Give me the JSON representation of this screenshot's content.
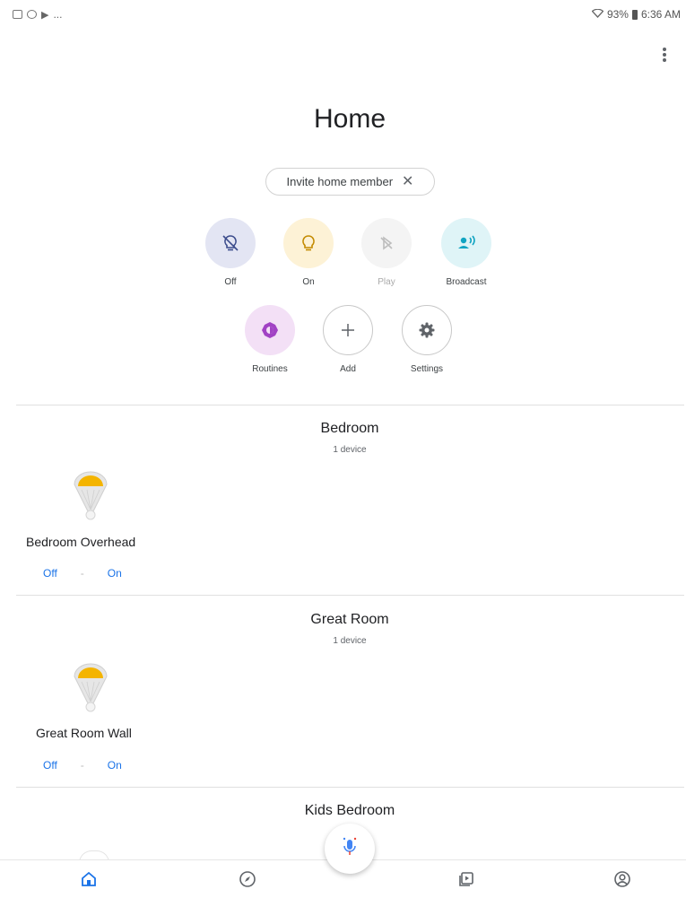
{
  "status_bar": {
    "left_extra": "...",
    "battery_text": "93%",
    "time": "6:36 AM"
  },
  "page": {
    "title": "Home"
  },
  "invite_chip": {
    "label": "Invite home member",
    "close": "✕"
  },
  "actions": {
    "off": "Off",
    "on": "On",
    "play": "Play",
    "broadcast": "Broadcast",
    "routines": "Routines",
    "add": "Add",
    "settings": "Settings"
  },
  "rooms": [
    {
      "name": "Bedroom",
      "count": "1 device",
      "device": {
        "name": "Bedroom Overhead",
        "off": "Off",
        "sep": "-",
        "on": "On"
      }
    },
    {
      "name": "Great Room",
      "count": "1 device",
      "device": {
        "name": "Great Room Wall",
        "off": "Off",
        "sep": "-",
        "on": "On"
      }
    },
    {
      "name": "Kids Bedroom"
    }
  ],
  "colors": {
    "accent_blue": "#1a73e8",
    "bulb_yellow": "#f4b400",
    "routines_purple": "#a142c4",
    "broadcast_teal": "#12a4c2"
  },
  "icons": {
    "off": "lightbulb-off-icon",
    "on": "lightbulb-icon",
    "play": "play-disabled-icon",
    "broadcast": "broadcast-icon",
    "routines": "routines-icon",
    "add": "plus-icon",
    "settings": "gear-icon",
    "mic": "microphone-icon",
    "nav_home": "home-icon",
    "nav_discover": "compass-icon",
    "nav_media": "media-icon",
    "nav_account": "account-icon"
  }
}
